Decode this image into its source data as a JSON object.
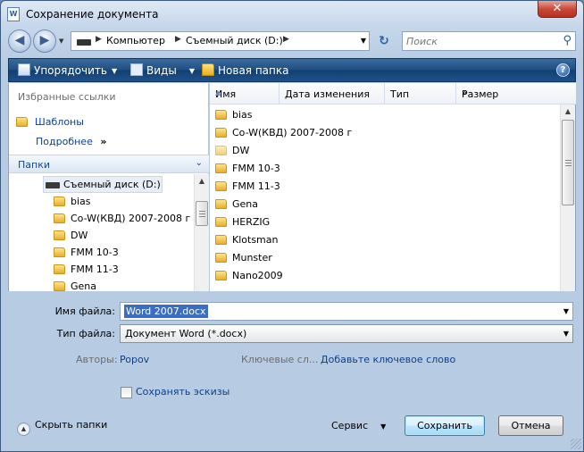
{
  "window": {
    "title": "Сохранение документа",
    "app_icon_text": "W",
    "close_label": "✕"
  },
  "address_bar": {
    "crumbs": [
      "Компьютер",
      "Съемный диск (D:)"
    ],
    "search_placeholder": "Поиск"
  },
  "toolbar": {
    "organize_label": "Упорядочить",
    "views_label": "Виды",
    "new_folder_label": "Новая папка",
    "help_label": "?"
  },
  "navigation": {
    "favorites_header": "Избранные ссылки",
    "favorites": [
      "Шаблоны"
    ],
    "more_label": "Подробнее",
    "folders_header": "Папки",
    "drive_label": "Съемный диск (D:)",
    "tree_items": [
      "bias",
      "Co-W(КВД) 2007-2008 г",
      "DW",
      "FMM 10-3",
      "FMM 11-3",
      "Gena"
    ]
  },
  "file_list": {
    "columns": [
      "Имя",
      "Дата изменения",
      "Тип",
      "Размер"
    ],
    "more_columns": "»",
    "items": [
      "bias",
      "Co-W(КВД) 2007-2008 г",
      "DW",
      "FMM 10-3",
      "FMM 11-3",
      "Gena",
      "HERZIG",
      "Klotsman",
      "Munster",
      "Nano2009"
    ]
  },
  "form": {
    "filename_label": "Имя файла:",
    "filename_value": "Word 2007.docx",
    "filetype_label": "Тип файла:",
    "filetype_value": "Документ Word (*.docx)",
    "authors_label": "Авторы:",
    "authors_value": "Popov",
    "keywords_label": "Ключевые сл...",
    "keywords_value": "Добавьте ключевое слово",
    "thumbnails_label": "Сохранять эскизы"
  },
  "footer": {
    "hide_folders_label": "Скрыть папки",
    "tools_label": "Сервис",
    "save_label": "Сохранить",
    "cancel_label": "Отмена"
  },
  "colors": {
    "toolbar_bg": "#1f4f82",
    "link_blue": "#0e3f8a",
    "selection": "#3a6ec4"
  }
}
